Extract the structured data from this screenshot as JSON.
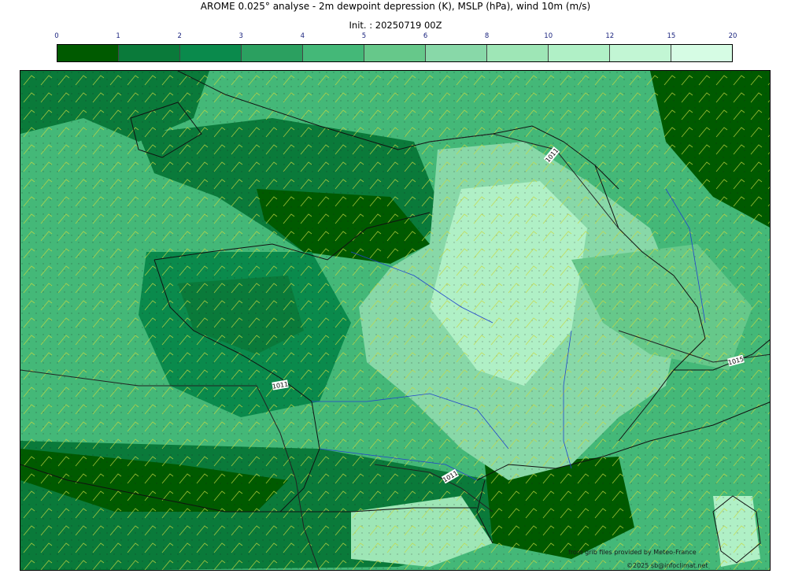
{
  "title": "AROME 0.025° analyse - 2m dewpoint depression (K), MSLP (hPa), wind 10m (m/s)",
  "init": "Init. : 20250719 00Z",
  "colorbar": {
    "ticks": [
      "0",
      "1",
      "2",
      "3",
      "4",
      "5",
      "6",
      "8",
      "10",
      "12",
      "15",
      "20"
    ],
    "colors": [
      "#005a00",
      "#0a7a3a",
      "#0a8a4c",
      "#2ba060",
      "#44b878",
      "#66c88a",
      "#88d8a8",
      "#9ee6b6",
      "#b0f0c6",
      "#c2f6d4",
      "#d6fce4"
    ]
  },
  "isobar_labels": [
    "1011",
    "1011",
    "1011",
    "1015"
  ],
  "credits": {
    "source": "from grib files provided by Meteo-France",
    "copyright": "©2025 sb@infoclimat.net"
  }
}
